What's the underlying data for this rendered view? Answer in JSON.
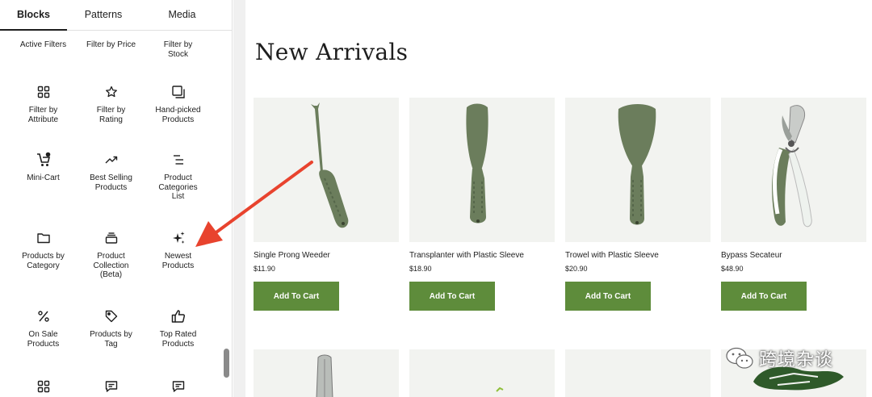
{
  "tabs": [
    {
      "label": "Blocks",
      "active": true
    },
    {
      "label": "Patterns",
      "active": false
    },
    {
      "label": "Media",
      "active": false
    }
  ],
  "blocks": [
    {
      "label": "Active Filters",
      "icon": "none"
    },
    {
      "label": "Filter by Price",
      "icon": "none"
    },
    {
      "label": "Filter by Stock",
      "icon": "none"
    },
    {
      "label": "Filter by Attribute",
      "icon": "grid-icon"
    },
    {
      "label": "Filter by Rating",
      "icon": "star-icon"
    },
    {
      "label": "Hand-picked Products",
      "icon": "stacked-squares-icon"
    },
    {
      "label": "Mini-Cart",
      "icon": "cart-icon"
    },
    {
      "label": "Best Selling Products",
      "icon": "trending-up-icon"
    },
    {
      "label": "Product Categories List",
      "icon": "list-icon"
    },
    {
      "label": "Products by Category",
      "icon": "folder-icon"
    },
    {
      "label": "Product Collection (Beta)",
      "icon": "collection-icon"
    },
    {
      "label": "Newest Products",
      "icon": "sparkles-icon"
    },
    {
      "label": "On Sale Products",
      "icon": "percent-icon"
    },
    {
      "label": "Products by Tag",
      "icon": "tag-icon"
    },
    {
      "label": "Top Rated Products",
      "icon": "thumbs-up-icon"
    },
    {
      "label": "",
      "icon": "grid-icon"
    },
    {
      "label": "",
      "icon": "comment-icon"
    },
    {
      "label": "",
      "icon": "comment-icon"
    }
  ],
  "canvas": {
    "heading": "New Arrivals",
    "products": [
      {
        "title": "Single Prong Weeder",
        "price": "$11.90",
        "button": "Add To Cart"
      },
      {
        "title": "Transplanter with Plastic Sleeve",
        "price": "$18.90",
        "button": "Add To Cart"
      },
      {
        "title": "Trowel with Plastic Sleeve",
        "price": "$20.90",
        "button": "Add To Cart"
      },
      {
        "title": "Bypass Secateur",
        "price": "$48.90",
        "button": "Add To Cart"
      }
    ]
  },
  "watermark": "跨境杂谈",
  "colors": {
    "button": "#5e8c3b",
    "arrow": "#e8432e",
    "tool_green": "#6b7d5c",
    "image_bg": "#f2f3f0"
  }
}
